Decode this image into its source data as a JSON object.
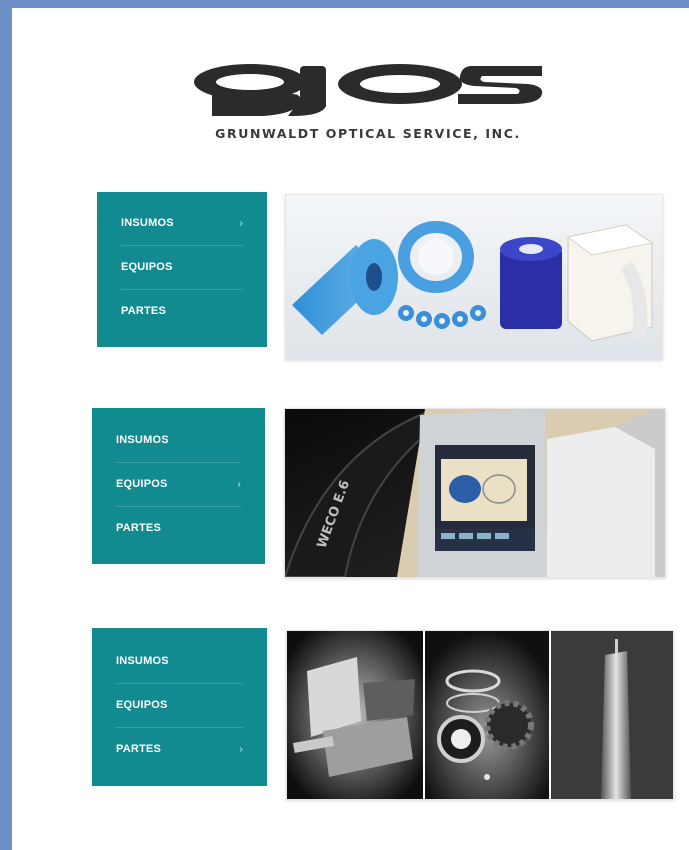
{
  "brand": {
    "logo_text": "gjos",
    "tagline": "GRUNWALDT OPTICAL SERVICE, INC."
  },
  "sections": [
    {
      "items": [
        {
          "label": "INSUMOS",
          "active": true
        },
        {
          "label": "EQUIPOS",
          "active": false
        },
        {
          "label": "PARTES",
          "active": false
        }
      ],
      "image": "supplies-tape-rolls-photo"
    },
    {
      "items": [
        {
          "label": "INSUMOS",
          "active": false
        },
        {
          "label": "EQUIPOS",
          "active": true
        },
        {
          "label": "PARTES",
          "active": false
        }
      ],
      "image": "weco-edger-machine-photo",
      "image_text": "WECO E.6"
    },
    {
      "items": [
        {
          "label": "INSUMOS",
          "active": false
        },
        {
          "label": "EQUIPOS",
          "active": false
        },
        {
          "label": "PARTES",
          "active": true
        }
      ],
      "image": "machine-parts-collage-photo"
    }
  ],
  "chevron": "›",
  "colors": {
    "menu_bg": "#118a90",
    "frame_bg": "#6c8fc7",
    "page_bg": "#ffffff"
  }
}
